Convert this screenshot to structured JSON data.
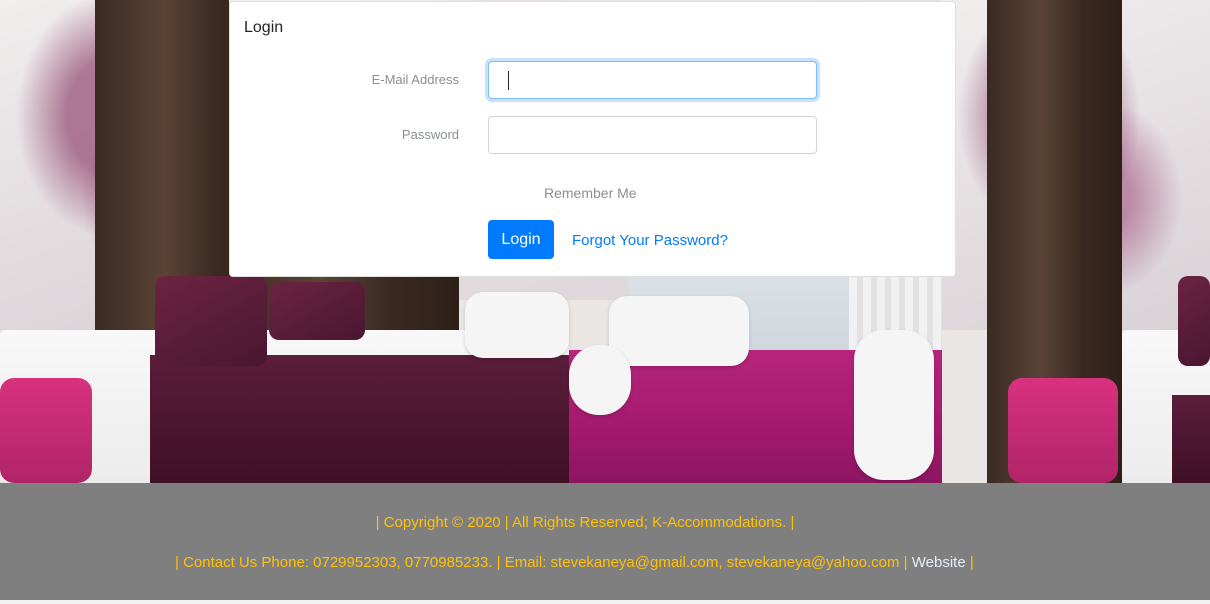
{
  "login": {
    "header": "Login",
    "email_label": "E-Mail Address",
    "email_value": "",
    "password_label": "Password",
    "password_value": "",
    "remember_label": "Remember Me",
    "login_button": "Login",
    "forgot_link": "Forgot Your Password?"
  },
  "footer": {
    "copyright": "| Copyright © 2020 | All Rights Reserved; K-Accommodations. |",
    "contact_prefix": "| Contact Us Phone: 0729952303, 0770985233. | Email: stevekaneya@gmail.com, stevekaneya@yahoo.com |",
    "website_link": "Website",
    "contact_suffix": "|"
  },
  "colors": {
    "primary": "#007bff",
    "footer_bg": "#7f7f7f",
    "footer_text": "#ffc107",
    "carpet": "#b5257c"
  }
}
